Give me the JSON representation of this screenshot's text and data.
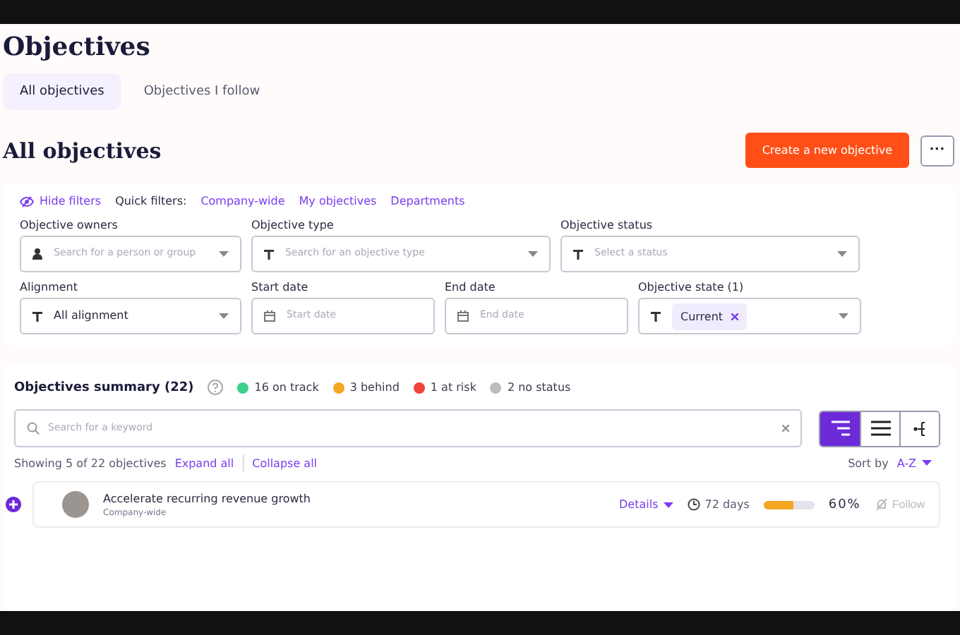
{
  "page": {
    "title": "Objectives"
  },
  "tabs": [
    {
      "label": "All objectives",
      "selected": true
    },
    {
      "label": "Objectives I follow",
      "selected": false
    }
  ],
  "section": {
    "title": "All objectives",
    "create_button": "Create a new objective",
    "more_button": "···"
  },
  "filters": {
    "hide_label": "Hide filters",
    "quick_label": "Quick filters:",
    "quick": [
      "Company-wide",
      "My objectives",
      "Departments"
    ],
    "fields": [
      {
        "label": "Objective owners",
        "kind": "select",
        "placeholder": "Search for a person or group"
      },
      {
        "label": "Objective type",
        "kind": "select",
        "placeholder": "Search for an objective type"
      },
      {
        "label": "Objective status",
        "kind": "select",
        "placeholder": "Select a status"
      },
      {
        "label": "Alignment",
        "kind": "select",
        "value": "All alignment"
      },
      {
        "label": "Start date",
        "kind": "date",
        "placeholder": "Start date"
      },
      {
        "label": "End date",
        "kind": "date",
        "placeholder": "End date"
      },
      {
        "label": "Objective state (1)",
        "kind": "select",
        "chip": "Current"
      }
    ]
  },
  "summary": {
    "title": "Objectives summary (22)",
    "statuses": [
      {
        "label": "16 on track",
        "color": "#3ecf8e"
      },
      {
        "label": "3 behind",
        "color": "#f5a623"
      },
      {
        "label": "1 at risk",
        "color": "#f0443a"
      },
      {
        "label": "2 no status",
        "color": "#bdbdbd"
      }
    ],
    "search_placeholder": "Search for a keyword",
    "views": [
      {
        "kind": "tree",
        "selected": true
      },
      {
        "kind": "list",
        "selected": false
      },
      {
        "kind": "hierarchy",
        "selected": false
      }
    ],
    "showing": "Showing 5 of 22 objectives",
    "expand": "Expand all",
    "collapse": "Collapse all",
    "sort_label": "Sort by",
    "sort_value": "A-Z"
  },
  "objectives": [
    {
      "title": "Accelerate recurring revenue growth",
      "scope": "Company-wide",
      "details": "Details",
      "days": "72 days",
      "level": 0.6,
      "percent": "60%",
      "follow": "Follow"
    }
  ]
}
